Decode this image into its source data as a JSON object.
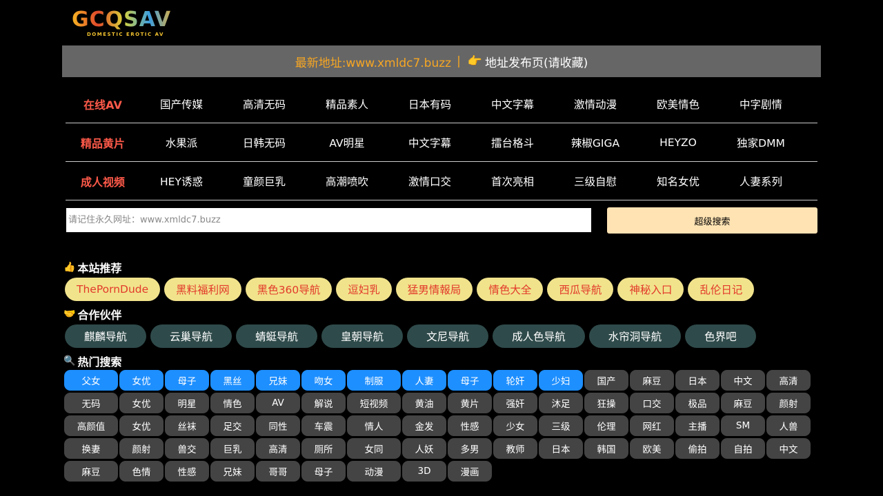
{
  "logo": {
    "text": "GCQSAV",
    "sub": "DOMESTIC EROTIC AV"
  },
  "address_bar": {
    "link": "最新地址:www.xmldc7.buzz",
    "separator": "|",
    "pointer_icon": "pointing-hand-icon",
    "page_label": "地址发布页(请收藏)"
  },
  "nav": [
    {
      "head": "在线AV",
      "items": [
        "国产传媒",
        "高清无码",
        "精品素人",
        "日本有码",
        "中文字幕",
        "激情动漫",
        "欧美情色",
        "中字剧情"
      ]
    },
    {
      "head": "精品黄片",
      "items": [
        "水果派",
        "日韩无码",
        "AV明星",
        "中文字幕",
        "擂台格斗",
        "辣椒GIGA",
        "HEYZO",
        "独家DMM"
      ]
    },
    {
      "head": "成人视频",
      "items": [
        "HEY诱惑",
        "童颜巨乳",
        "高潮喷吹",
        "激情口交",
        "首次亮相",
        "三级自慰",
        "知名女优",
        "人妻系列"
      ]
    }
  ],
  "search": {
    "placeholder": "请记住永久网址：www.xmldc7.buzz",
    "button": "超级搜索"
  },
  "recommend": {
    "title": "本站推荐",
    "icon": "thumbs-up-icon",
    "items": [
      "ThePornDude",
      "黑料福利网",
      "黑色360导航",
      "逗妇乳",
      "猛男情報局",
      "情色大全",
      "西瓜导航",
      "神秘入口",
      "乱伦日记"
    ]
  },
  "partners": {
    "title": "合作伙伴",
    "icon": "handshake-icon",
    "items": [
      "麒麟导航",
      "云巢导航",
      "蜻蜓导航",
      "皇朝导航",
      "文尼导航",
      "成人色导航",
      "水帘洞导航",
      "色界吧"
    ]
  },
  "hot": {
    "title": "热门搜索",
    "icon": "magnifier-icon",
    "rows": [
      [
        "父女",
        "女优",
        "母子",
        "黑丝",
        "兄妹",
        "吻女",
        "制服",
        "人妻",
        "母子",
        "轮奸",
        "少妇",
        "国产",
        "麻豆",
        "日本",
        "中文",
        "高清"
      ],
      [
        "无码",
        "女优",
        "明星",
        "情色",
        "AV",
        "解说",
        "短视频",
        "黄油",
        "黄片",
        "强奸",
        "沐足",
        "狂操",
        "口交",
        "极品",
        "麻豆",
        "颜射"
      ],
      [
        "高颜值",
        "女优",
        "丝袜",
        "足交",
        "同性",
        "车震",
        "情人",
        "金发",
        "性感",
        "少女",
        "三级",
        "伦理",
        "网红",
        "主播",
        "SM",
        "人兽"
      ],
      [
        "换妻",
        "颜射",
        "兽交",
        "巨乳",
        "高清",
        "厕所",
        "女同",
        "人妖",
        "多男",
        "教师",
        "日本",
        "韩国",
        "欧美",
        "偷拍",
        "自拍",
        "中文"
      ],
      [
        "麻豆",
        "色情",
        "性感",
        "兄妹",
        "哥哥",
        "母子",
        "动漫",
        "3D",
        "漫画"
      ]
    ],
    "blue_count_first_row": 11
  },
  "colors": {
    "background": "#000000",
    "address_bar": "#666666",
    "nav_head": "#ff5a4a",
    "link_orange": "#f6a623",
    "search_button": "#ffe3b3",
    "pill_yellow": "#f1e38c",
    "pill_yellow_text": "#e23a2a",
    "pill_dark": "#2f4a4a",
    "tag_blue": "#1e8fff",
    "tag_gray": "#444444"
  }
}
